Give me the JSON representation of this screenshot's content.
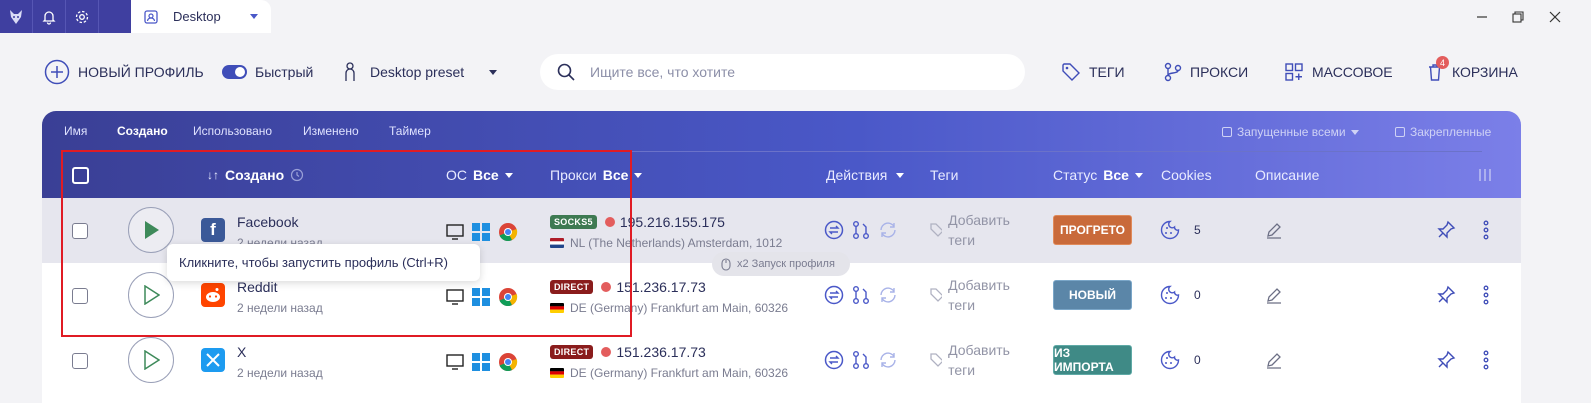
{
  "titlebar": {
    "tab_label": "Desktop"
  },
  "toolbar": {
    "new_profile": "НОВЫЙ ПРОФИЛЬ",
    "fast": "Быстрый",
    "preset": "Desktop preset",
    "search_placeholder": "Ищите все, что хотите",
    "tags": "ТЕГИ",
    "proxies": "ПРОКСИ",
    "bulk": "МАССОВОЕ",
    "trash": "КОРЗИНА",
    "trash_badge": "4"
  },
  "sort_tabs": [
    "Имя",
    "Создано",
    "Использовано",
    "Изменено",
    "Таймер"
  ],
  "filters": {
    "run_all": "Запущенные всеми",
    "pinned": "Закрепленные"
  },
  "headers": {
    "created": "Создано",
    "sort_arrows": "↓↑",
    "os": "ОС",
    "os_value": "Все",
    "proxy": "Прокси",
    "proxy_value": "Все",
    "actions": "Действия",
    "tags": "Теги",
    "status": "Статус",
    "status_value": "Все",
    "cookies": "Cookies",
    "description": "Описание"
  },
  "rows": [
    {
      "name": "Facebook",
      "created": "2 недели назад",
      "proxy_type": "SOCKS5",
      "ip": "195.216.155.175",
      "location": "NL (The Netherlands) Amsterdam, 1012",
      "tags": "Добавить теги",
      "status": "ПРОГРЕТО",
      "cookies": "5"
    },
    {
      "name": "Reddit",
      "created": "2 недели назад",
      "proxy_type": "DIRECT",
      "ip": "151.236.17.73",
      "location": "DE (Germany) Frankfurt am Main, 60326",
      "tags": "Добавить теги",
      "status": "НОВЫЙ",
      "cookies": "0"
    },
    {
      "name": "X",
      "created": "2 недели назад",
      "proxy_type": "DIRECT",
      "ip": "151.236.17.73",
      "location": "DE (Germany) Frankfurt am Main, 60326",
      "tags": "Добавить теги",
      "status": "ИЗ ИМПОРТА",
      "cookies": "0"
    }
  ],
  "status_colors": {
    "warm": "#c96a3a",
    "new": "#5b86a8",
    "import": "#3f8a86"
  },
  "tooltip": "Кликните, чтобы запустить профиль (Ctrl+R)",
  "hint": "x2 Запуск профиля"
}
